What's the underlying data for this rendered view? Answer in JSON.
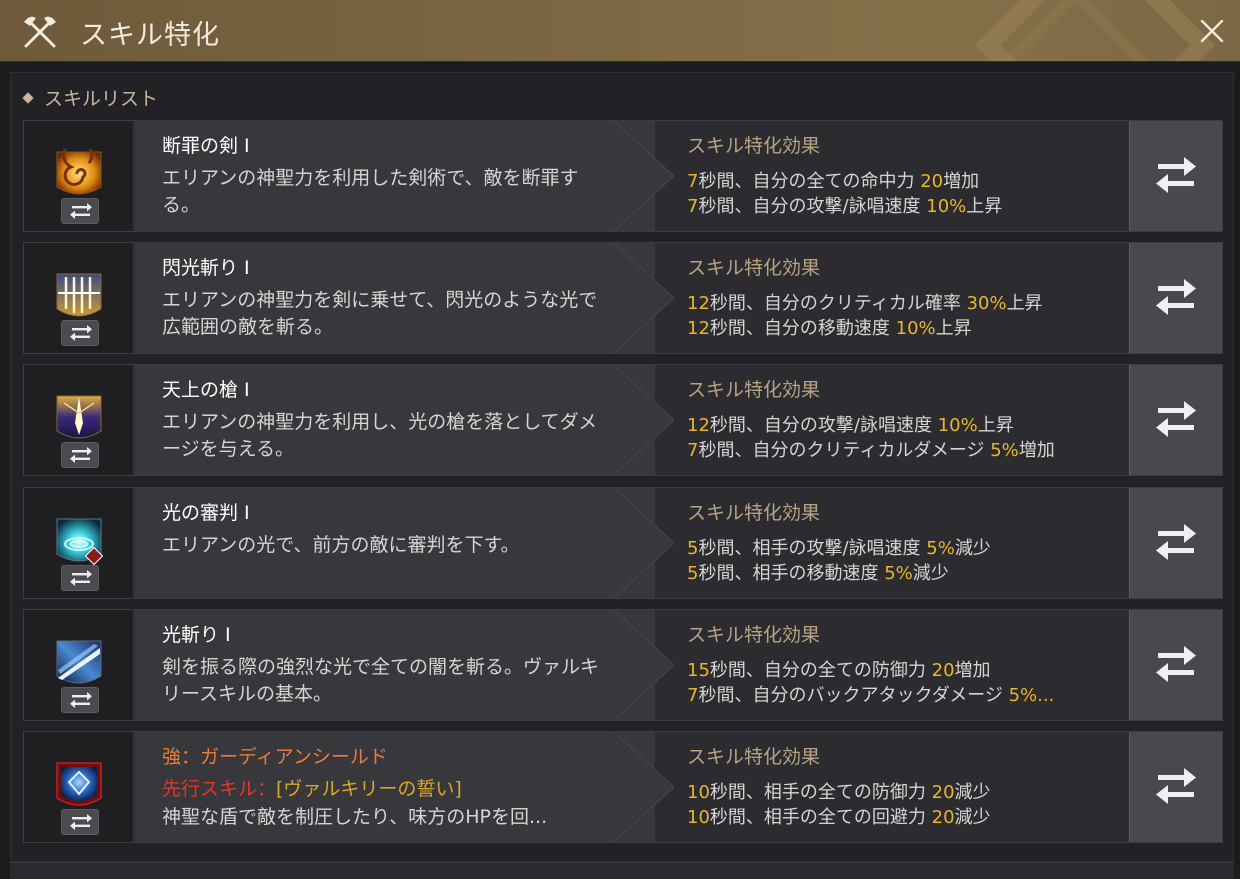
{
  "window": {
    "title": "スキル特化",
    "title_icon": "crossed-axes-icon",
    "close_icon": "close-icon"
  },
  "section": {
    "label": "スキルリスト"
  },
  "skills": [
    {
      "name": "断罪の剣 I",
      "icon": "golden-spiral-icon",
      "desc": "エリアンの神聖力を利用した剣術で、敵を断罪する。",
      "effect_title": "スキル特化効果",
      "effects": [
        {
          "n1": "7",
          "t1": "秒間、自分の全ての命中力 ",
          "n2": "20",
          "t2": "増加"
        },
        {
          "n1": "7",
          "t1": "秒間、自分の攻撃/詠唱速度 ",
          "n2": "10%",
          "t2": "上昇"
        }
      ]
    },
    {
      "name": "閃光斬り I",
      "icon": "flash-slash-icon",
      "desc": "エリアンの神聖力を剣に乗せて、閃光のような光で広範囲の敵を斬る。",
      "effect_title": "スキル特化効果",
      "effects": [
        {
          "n1": "12",
          "t1": "秒間、自分のクリティカル確率 ",
          "n2": "30%",
          "t2": "上昇"
        },
        {
          "n1": "12",
          "t1": "秒間、自分の移動速度 ",
          "n2": "10%",
          "t2": "上昇"
        }
      ]
    },
    {
      "name": "天上の槍 I",
      "icon": "heavenly-spear-icon",
      "desc": "エリアンの神聖力を利用し、光の槍を落としてダメージを与える。",
      "effect_title": "スキル特化効果",
      "effects": [
        {
          "n1": "12",
          "t1": "秒間、自分の攻撃/詠唱速度 ",
          "n2": "10%",
          "t2": "上昇"
        },
        {
          "n1": "7",
          "t1": "秒間、自分のクリティカルダメージ ",
          "n2": "5%",
          "t2": "増加"
        }
      ]
    },
    {
      "name": "光の審判 I",
      "icon": "light-judgment-icon",
      "desc": "エリアンの光で、前方の敵に審判を下す。",
      "effect_title": "スキル特化効果",
      "effects": [
        {
          "n1": "5",
          "t1": "秒間、相手の攻撃/詠唱速度 ",
          "n2": "5%",
          "t2": "減少"
        },
        {
          "n1": "5",
          "t1": "秒間、相手の移動速度 ",
          "n2": "5%",
          "t2": "減少"
        }
      ]
    },
    {
      "name": "光斬り I",
      "icon": "light-slash-icon",
      "desc": "剣を振る際の強烈な光で全ての闇を斬る。ヴァルキリースキルの基本。",
      "effect_title": "スキル特化効果",
      "effects": [
        {
          "n1": "15",
          "t1": "秒間、自分の全ての防御力 ",
          "n2": "20",
          "t2": "増加"
        },
        {
          "n1": "7",
          "t1": "秒間、自分のバックアタックダメージ ",
          "n2": "5%...",
          "t2": ""
        }
      ]
    },
    {
      "name": "強：ガーディアンシールド",
      "icon": "guardian-shield-icon",
      "prereq_label": "先行スキル：",
      "prereq_skill": "[ヴァルキリーの誓い]",
      "desc": "神聖な盾で敵を制圧したり、味方のHPを回...",
      "effect_title": "スキル特化効果",
      "effects": [
        {
          "n1": "10",
          "t1": "秒間、相手の全ての防御力 ",
          "n2": "20",
          "t2": "減少"
        },
        {
          "n1": "10",
          "t1": "秒間、相手の全ての回避力 ",
          "n2": "20",
          "t2": "減少"
        }
      ]
    }
  ],
  "swap_icon": "swap-arrows-icon",
  "colors": {
    "title_bar": "#7a6542",
    "highlight_number": "#e9b52a",
    "effect_title": "#b8a384",
    "enhanced_name": "#e97c3a",
    "prereq": "#e5352b"
  }
}
